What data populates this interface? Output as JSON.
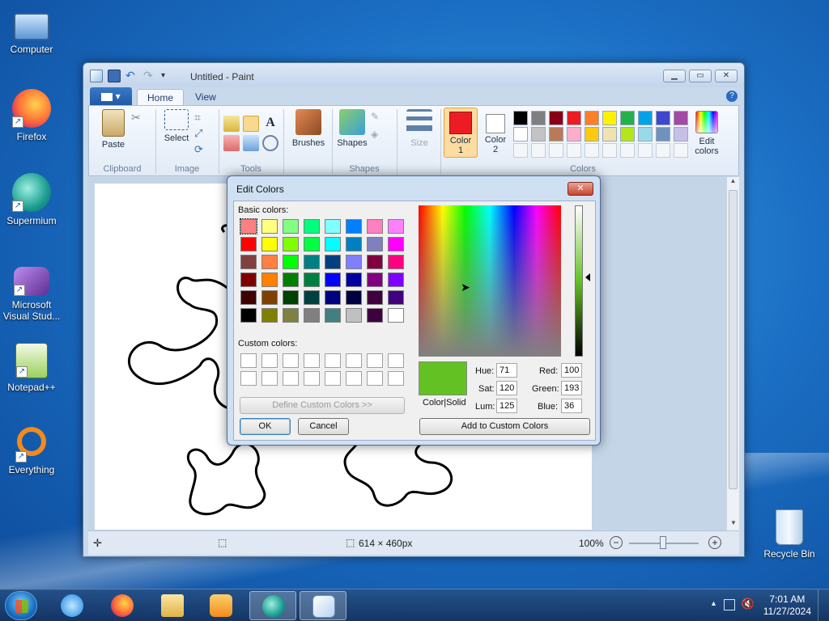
{
  "desktop": {
    "icons": [
      {
        "label": "Computer"
      },
      {
        "label": "Firefox"
      },
      {
        "label": "Supermium"
      },
      {
        "label": "Microsoft Visual Stud..."
      },
      {
        "label": "Notepad++"
      },
      {
        "label": "Everything"
      },
      {
        "label": "Recycle Bin"
      }
    ]
  },
  "paint": {
    "title": "Untitled - Paint",
    "tabs": {
      "file": "▾",
      "home": "Home",
      "view": "View"
    },
    "help": "?",
    "window_controls": {
      "minimize": "▁",
      "maximize": "▭",
      "close": "✕"
    },
    "groups": {
      "clipboard": "Clipboard",
      "image": "Image",
      "tools": "Tools",
      "shapes": "Shapes",
      "colors": "Colors"
    },
    "buttons": {
      "paste": "Paste",
      "select": "Select",
      "brushes": "Brushes",
      "shapes": "Shapes",
      "size": "Size",
      "color1": "Color\n1",
      "color1_line1": "Color",
      "color1_line2": "1",
      "color2_line1": "Color",
      "color2_line2": "2",
      "edit_colors_line1": "Edit",
      "edit_colors_line2": "colors"
    },
    "palette_row1": [
      "#000000",
      "#7f7f7f",
      "#880015",
      "#ed1c24",
      "#ff7f27",
      "#fff200",
      "#22b14c",
      "#00a2e8",
      "#3f48cc",
      "#a349a4"
    ],
    "palette_row2": [
      "#ffffff",
      "#c3c3c3",
      "#b97a57",
      "#ffaec9",
      "#ffc90e",
      "#efe4b0",
      "#b5e61d",
      "#99d9ea",
      "#7092be",
      "#c8bfe7"
    ],
    "color1": "#ed1c24",
    "color2": "#ffffff",
    "status": {
      "dimensions": "614 × 460px",
      "zoom": "100%"
    }
  },
  "dialog": {
    "title": "Edit Colors",
    "close": "✕",
    "basic_colors_label": "Basic colors:",
    "custom_colors_label": "Custom colors:",
    "define_custom": "Define Custom Colors >>",
    "ok": "OK",
    "cancel": "Cancel",
    "add_custom": "Add to Custom Colors",
    "color_solid": "Color|Solid",
    "basic_colors": [
      [
        "#ff8080",
        "#ffff80",
        "#80ff80",
        "#00ff80",
        "#80ffff",
        "#0080ff",
        "#ff80c0",
        "#ff80ff"
      ],
      [
        "#ff0000",
        "#ffff00",
        "#80ff00",
        "#00ff40",
        "#00ffff",
        "#0080c0",
        "#8080c0",
        "#ff00ff"
      ],
      [
        "#804040",
        "#ff8040",
        "#00ff00",
        "#008080",
        "#004080",
        "#8080ff",
        "#800040",
        "#ff0080"
      ],
      [
        "#800000",
        "#ff8000",
        "#008000",
        "#008040",
        "#0000ff",
        "#0000a0",
        "#800080",
        "#8000ff"
      ],
      [
        "#400000",
        "#804000",
        "#004000",
        "#004040",
        "#000080",
        "#000040",
        "#400040",
        "#400080"
      ],
      [
        "#000000",
        "#808000",
        "#808040",
        "#808080",
        "#408080",
        "#c0c0c0",
        "#400040",
        "#ffffff"
      ]
    ],
    "current_color": "#64c124",
    "fields": {
      "hue_label": "Hue:",
      "hue": "71",
      "sat_label": "Sat:",
      "sat": "120",
      "lum_label": "Lum:",
      "lum": "125",
      "red_label": "Red:",
      "red": "100",
      "green_label": "Green:",
      "green": "193",
      "blue_label": "Blue:",
      "blue": "36"
    }
  },
  "taskbar": {
    "clock_time": "7:01 AM",
    "clock_date": "11/27/2024",
    "tray_arrow": "▴"
  }
}
